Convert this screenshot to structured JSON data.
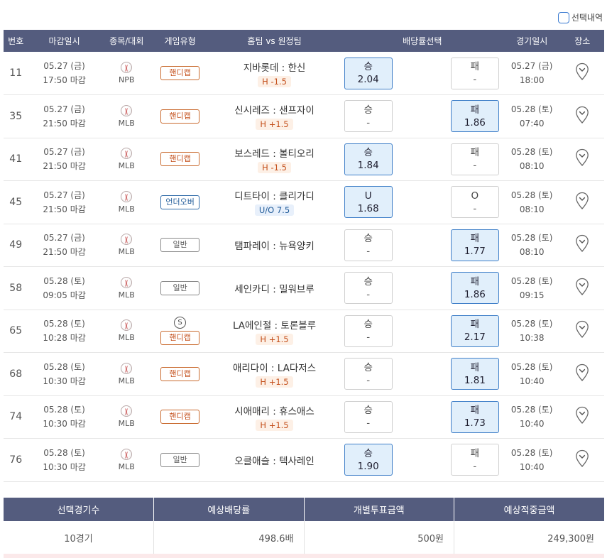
{
  "selection_toggle": {
    "label": "선택내역"
  },
  "headers": {
    "no": "번호",
    "deadline": "마감일시",
    "sport": "종목/대회",
    "game_type": "게임유형",
    "matchup": "홈팀 vs 원정팀",
    "odds_select": "배당률선택",
    "game_time": "경기일시",
    "venue": "장소"
  },
  "games": [
    {
      "no": "11",
      "deadline_date": "05.27 (금)",
      "deadline_time": "17:50 마감",
      "league": "NPB",
      "type": "핸디캡",
      "type_class": "handicap",
      "special": "",
      "teams": "지바롯데 : 한신",
      "line": "H -1.5",
      "line_class": "hc",
      "left_label": "승",
      "left_value": "2.04",
      "left_selected": true,
      "right_label": "패",
      "right_value": "-",
      "right_selected": false,
      "game_date": "05.27 (금)",
      "game_time": "18:00"
    },
    {
      "no": "35",
      "deadline_date": "05.27 (금)",
      "deadline_time": "21:50 마감",
      "league": "MLB",
      "type": "핸디캡",
      "type_class": "handicap",
      "special": "",
      "teams": "신시레즈 : 샌프자이",
      "line": "H +1.5",
      "line_class": "hc",
      "left_label": "승",
      "left_value": "-",
      "left_selected": false,
      "right_label": "패",
      "right_value": "1.86",
      "right_selected": true,
      "game_date": "05.28 (토)",
      "game_time": "07:40"
    },
    {
      "no": "41",
      "deadline_date": "05.27 (금)",
      "deadline_time": "21:50 마감",
      "league": "MLB",
      "type": "핸디캡",
      "type_class": "handicap",
      "special": "",
      "teams": "보스레드 : 볼티오리",
      "line": "H -1.5",
      "line_class": "hc",
      "left_label": "승",
      "left_value": "1.84",
      "left_selected": true,
      "right_label": "패",
      "right_value": "-",
      "right_selected": false,
      "game_date": "05.28 (토)",
      "game_time": "08:10"
    },
    {
      "no": "45",
      "deadline_date": "05.27 (금)",
      "deadline_time": "21:50 마감",
      "league": "MLB",
      "type": "언더오버",
      "type_class": "overunder",
      "special": "",
      "teams": "디트타이 : 클리가디",
      "line": "U/O 7.5",
      "line_class": "ou",
      "left_label": "U",
      "left_value": "1.68",
      "left_selected": true,
      "right_label": "O",
      "right_value": "-",
      "right_selected": false,
      "game_date": "05.28 (토)",
      "game_time": "08:10"
    },
    {
      "no": "49",
      "deadline_date": "05.27 (금)",
      "deadline_time": "21:50 마감",
      "league": "MLB",
      "type": "일반",
      "type_class": "normal",
      "special": "",
      "teams": "탬파레이 : 뉴욕양키",
      "line": "",
      "line_class": "",
      "left_label": "승",
      "left_value": "-",
      "left_selected": false,
      "right_label": "패",
      "right_value": "1.77",
      "right_selected": true,
      "game_date": "05.28 (토)",
      "game_time": "08:10"
    },
    {
      "no": "58",
      "deadline_date": "05.28 (토)",
      "deadline_time": "09:05 마감",
      "league": "MLB",
      "type": "일반",
      "type_class": "normal",
      "special": "",
      "teams": "세인카디 : 밀워브루",
      "line": "",
      "line_class": "",
      "left_label": "승",
      "left_value": "-",
      "left_selected": false,
      "right_label": "패",
      "right_value": "1.86",
      "right_selected": true,
      "game_date": "05.28 (토)",
      "game_time": "09:15"
    },
    {
      "no": "65",
      "deadline_date": "05.28 (토)",
      "deadline_time": "10:28 마감",
      "league": "MLB",
      "type": "핸디캡",
      "type_class": "handicap",
      "special": "S",
      "teams": "LA에인절 : 토론블루",
      "line": "H +1.5",
      "line_class": "hc",
      "left_label": "승",
      "left_value": "-",
      "left_selected": false,
      "right_label": "패",
      "right_value": "2.17",
      "right_selected": true,
      "game_date": "05.28 (토)",
      "game_time": "10:38"
    },
    {
      "no": "68",
      "deadline_date": "05.28 (토)",
      "deadline_time": "10:30 마감",
      "league": "MLB",
      "type": "핸디캡",
      "type_class": "handicap",
      "special": "",
      "teams": "애리다이 : LA다저스",
      "line": "H +1.5",
      "line_class": "hc",
      "left_label": "승",
      "left_value": "-",
      "left_selected": false,
      "right_label": "패",
      "right_value": "1.81",
      "right_selected": true,
      "game_date": "05.28 (토)",
      "game_time": "10:40"
    },
    {
      "no": "74",
      "deadline_date": "05.28 (토)",
      "deadline_time": "10:30 마감",
      "league": "MLB",
      "type": "핸디캡",
      "type_class": "handicap",
      "special": "",
      "teams": "시애매리 : 휴스애스",
      "line": "H +1.5",
      "line_class": "hc",
      "left_label": "승",
      "left_value": "-",
      "left_selected": false,
      "right_label": "패",
      "right_value": "1.73",
      "right_selected": true,
      "game_date": "05.28 (토)",
      "game_time": "10:40"
    },
    {
      "no": "76",
      "deadline_date": "05.28 (토)",
      "deadline_time": "10:30 마감",
      "league": "MLB",
      "type": "일반",
      "type_class": "normal",
      "special": "",
      "teams": "오클애슬 : 텍사레인",
      "line": "",
      "line_class": "",
      "left_label": "승",
      "left_value": "1.90",
      "left_selected": true,
      "right_label": "패",
      "right_value": "-",
      "right_selected": false,
      "game_date": "05.28 (토)",
      "game_time": "10:40"
    }
  ],
  "summary": {
    "headers": [
      "선택경기수",
      "예상배당률",
      "개별투표금액",
      "예상적중금액"
    ],
    "values": [
      "10경기",
      "498.6배",
      "500원",
      "249,300원"
    ]
  },
  "colors": {
    "header_bg": "#545c7e",
    "selected_bg": "#e1effb",
    "selected_border": "#3f7fc8",
    "handicap": "#c4501c",
    "overunder": "#1f5a98"
  },
  "icons": {
    "sport": "baseball-icon",
    "venue": "map-pin-icon",
    "special": "s-circle-icon"
  }
}
